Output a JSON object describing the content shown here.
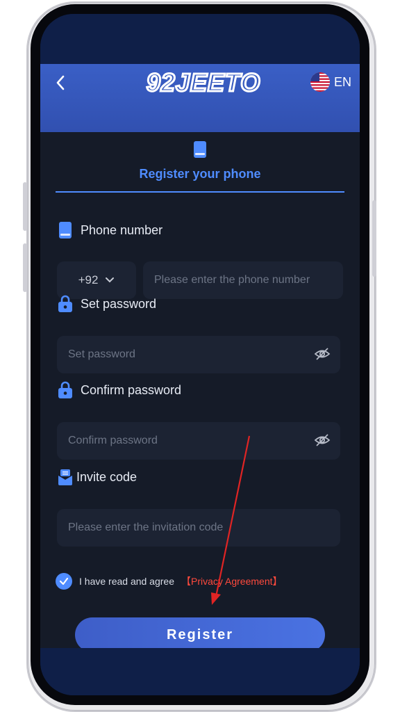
{
  "header": {
    "logo_text": "92JEETO",
    "language": "EN"
  },
  "tab": {
    "label": "Register your phone"
  },
  "phone": {
    "label": "Phone number",
    "country_code": "+92",
    "placeholder": "Please enter the phone number"
  },
  "password": {
    "label": "Set password",
    "placeholder": "Set password"
  },
  "confirm": {
    "label": "Confirm password",
    "placeholder": "Confirm password"
  },
  "invite": {
    "label": "Invite code",
    "placeholder": "Please enter the invitation code"
  },
  "agreement": {
    "text": "I have read and agree",
    "link": "【Privacy Agreement】"
  },
  "register": {
    "label": "Register"
  },
  "colors": {
    "accent": "#4f8cff",
    "header": "#3a5fc6",
    "background": "#151b28",
    "field": "#1c2333",
    "link": "#ff4a3d",
    "annotation_arrow": "#e02424"
  },
  "icons": [
    "back-chevron-icon",
    "us-flag-icon",
    "phone-icon",
    "lock-icon",
    "invite-icon",
    "chevron-down-icon",
    "eye-off-icon",
    "checkmark-icon"
  ]
}
